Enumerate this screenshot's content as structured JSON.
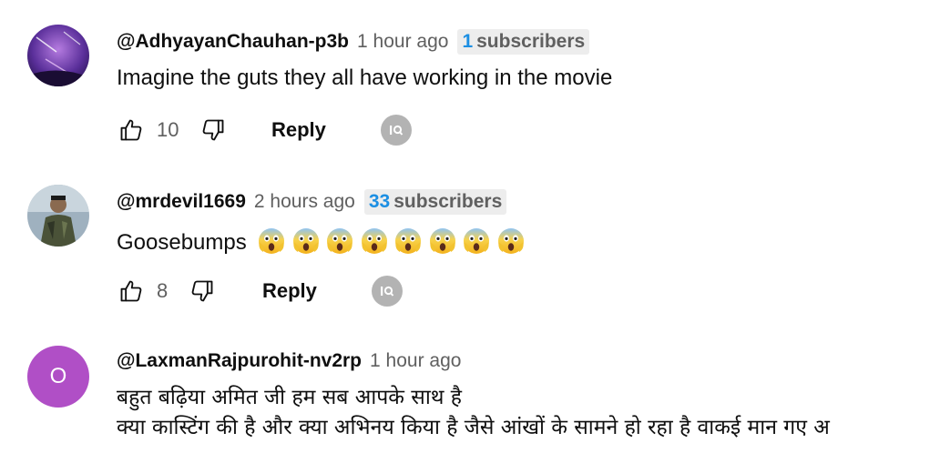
{
  "comments": [
    {
      "author": "@AdhyayanChauhan-p3b",
      "time": "1 hour ago",
      "subscriber_count": "1",
      "subscriber_label": "subscribers",
      "text": "Imagine the guts they all have working in the movie",
      "likes": "10",
      "reply_label": "Reply",
      "avatar_colors": [
        "#3a1f6b",
        "#8a4cc9",
        "#e8a9f0"
      ]
    },
    {
      "author": "@mrdevil1669",
      "time": "2 hours ago",
      "subscriber_count": "33",
      "subscriber_label": "subscribers",
      "text": "Goosebumps",
      "emoji_count": 8,
      "emoji_name": "face-screaming-in-fear",
      "likes": "8",
      "reply_label": "Reply",
      "avatar_colors": [
        "#6a7f90",
        "#c8d4dc",
        "#3b3f2e"
      ]
    },
    {
      "author": "@LaxmanRajpurohit-nv2rp",
      "time": "1 hour ago",
      "avatar_letter": "O",
      "avatar_color": "#b04fc6",
      "text_lines": [
        "बहुत बढ़िया अमित जी हम सब आपके साथ है",
        "क्या कास्टिंग की है और क्या अभिनय किया है जैसे आंखों के सामने हो रहा है वाकई मान गए अ"
      ]
    }
  ],
  "colors": {
    "subscriber_accent": "#1c8fe3",
    "muted": "#606060",
    "badge_bg": "#ededed"
  },
  "icons": [
    "thumbs-up-icon",
    "thumbs-down-icon",
    "creator-badge-icon"
  ]
}
